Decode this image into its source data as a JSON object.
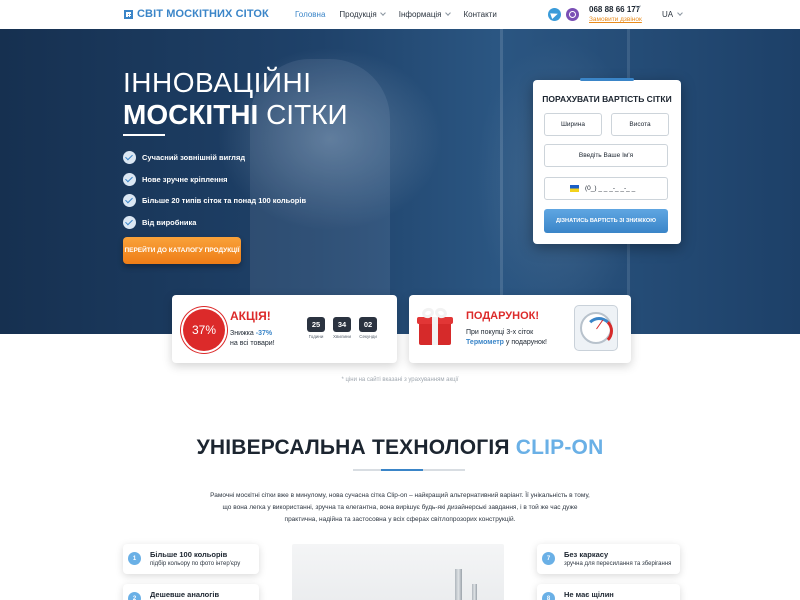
{
  "header": {
    "logo": "СВІТ МОСКІТНИХ СІТОК",
    "nav": [
      {
        "label": "Головна"
      },
      {
        "label": "Продукція"
      },
      {
        "label": "Інформація"
      },
      {
        "label": "Контакти"
      }
    ],
    "phone": "068 88 66 177",
    "callback": "Замовити дзвінок",
    "lang": "UA"
  },
  "hero": {
    "title_line1": "ІННОВАЦІЙНІ",
    "title_bold": "МОСКІТНІ",
    "title_rest": " СІТКИ",
    "bullets": [
      "Сучасний зовнішній вигляд",
      "Нове зручне кріплення",
      "Більше 20 типів сіток та понад 100 кольорів",
      "Від виробника"
    ],
    "cta": "ПЕРЕЙТИ ДО КАТАЛОГУ ПРОДУКЦІЇ"
  },
  "calc": {
    "title": "ПОРАХУВАТИ ВАРТІСТЬ СІТКИ",
    "width_placeholder": "Ширина",
    "height_placeholder": "Висота",
    "name_placeholder": "Введіть Ваше Ім'я",
    "phone_placeholder": "(0_) _ _ _-_ _-_ _",
    "button": "ДІЗНАТИСЬ ВАРТІСТЬ ЗІ ЗНИЖКОЮ"
  },
  "sale": {
    "badge": "37%",
    "title": "АКЦІЯ!",
    "text_pre": "Знижка ",
    "text_hl": "-37%",
    "text_post": "на всі товари!",
    "timer": [
      {
        "value": "25",
        "label": "Години"
      },
      {
        "value": "34",
        "label": "Хвилини"
      },
      {
        "value": "02",
        "label": "Секунди"
      }
    ]
  },
  "gift": {
    "title": "ПОДАРУНОК!",
    "text_pre": "При покупці 3-х сіток",
    "text_hl": "Термометр",
    "text_post": " у подарунок!"
  },
  "price_note": "* ціни на сайті вказані з урахуванням акції",
  "section": {
    "title_dark": "УНІВЕРСАЛЬНА ТЕХНОЛОГІЯ ",
    "title_blue": "CLIP-ON",
    "description": "Рамочні москітні сітки вже в минулому, нова сучасна сітка Clip-on – найкращий альтернативний варіант. Її унікальність в тому, що вона легка у використанні, зручна та елегантна, вона вирішує будь-які дизайнерські завдання, і в той же час дуже практична, надійна та застосовна у всіх сферах світлопрозорих конструкцій.",
    "features": [
      {
        "num": "1",
        "title": "Більше 100 кольорів",
        "sub": "підбір кольору по фото інтер'єру"
      },
      {
        "num": "2",
        "title": "Дешевше аналогів",
        "sub": ""
      },
      {
        "num": "7",
        "title": "Без каркасу",
        "sub": "зручна для пересилання та зберігання"
      },
      {
        "num": "8",
        "title": "Не має щілин",
        "sub": ""
      }
    ]
  }
}
